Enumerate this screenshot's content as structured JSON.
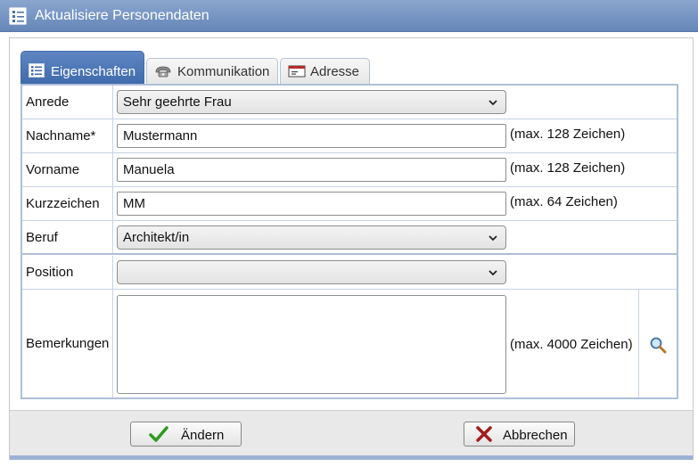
{
  "window": {
    "title": "Aktualisiere Personendaten",
    "icon": "list-icon"
  },
  "tabs": [
    {
      "label": "Eigenschaften",
      "icon": "list-icon",
      "active": true
    },
    {
      "label": "Kommunikation",
      "icon": "phone-icon",
      "active": false
    },
    {
      "label": "Adresse",
      "icon": "address-card-icon",
      "active": false
    }
  ],
  "form": {
    "anrede": {
      "label": "Anrede",
      "value": "Sehr geehrte Frau"
    },
    "nachname": {
      "label": "Nachname*",
      "value": "Mustermann",
      "hint": "(max. 128 Zeichen)"
    },
    "vorname": {
      "label": "Vorname",
      "value": "Manuela",
      "hint": "(max. 128 Zeichen)"
    },
    "kurzzeichen": {
      "label": "Kurzzeichen",
      "value": "MM",
      "hint": "(max. 64 Zeichen)"
    },
    "beruf": {
      "label": "Beruf",
      "value": "Architekt/in"
    },
    "position": {
      "label": "Position",
      "value": ""
    },
    "bemerkungen": {
      "label": "Bemerkungen",
      "value": "",
      "hint": "(max. 4000 Zeichen)",
      "icon": "magnifier-icon"
    }
  },
  "buttons": {
    "save": {
      "label": "Ändern",
      "icon": "checkmark-icon"
    },
    "cancel": {
      "label": "Abbrechen",
      "icon": "x-icon"
    }
  },
  "colors": {
    "titlebar": "#6586b8",
    "active_tab": "#3f6aac",
    "grid_border": "#aebfd8",
    "check": "#2e9b1f",
    "cancel_x": "#a51c1c"
  }
}
